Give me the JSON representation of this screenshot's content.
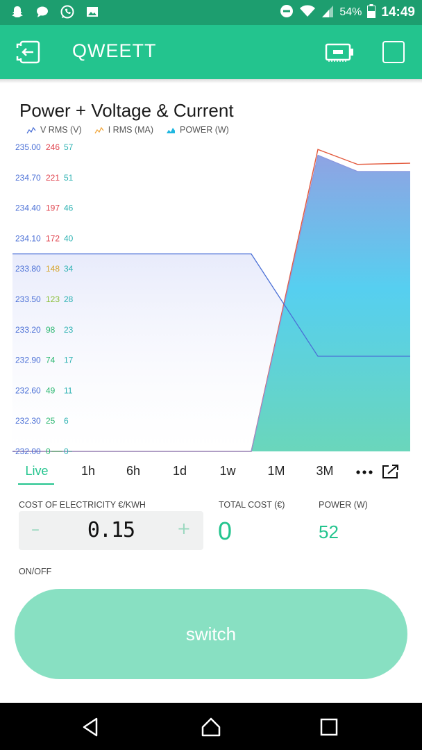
{
  "status_bar": {
    "notifications": [
      "snapchat-icon",
      "chat-icon",
      "whatsapp-icon",
      "gallery-icon"
    ],
    "battery_percent": "54%",
    "time": "14:49"
  },
  "app_bar": {
    "title": "QWEETT"
  },
  "chart": {
    "title": "Power + Voltage & Current",
    "legend": [
      {
        "label": "V RMS (V)",
        "color": "#4a6fd6",
        "icon": "line-chart-icon"
      },
      {
        "label": "I RMS (MA)",
        "color": "#f0a53a",
        "icon": "line-chart-icon"
      },
      {
        "label": "POWER (W)",
        "color": "#1fb7e0",
        "icon": "area-chart-icon"
      }
    ]
  },
  "chart_data": {
    "type": "area",
    "title": "Power + Voltage & Current",
    "xlabel": "",
    "ylabel": "",
    "axes": [
      {
        "name": "V RMS (V)",
        "color": "#4a6fd6",
        "ticks": [
          "235.00",
          "234.70",
          "234.40",
          "234.10",
          "233.80",
          "233.50",
          "233.20",
          "232.90",
          "232.60",
          "232.30",
          "232.00"
        ],
        "ylim": [
          232.0,
          235.0
        ]
      },
      {
        "name": "I RMS (MA)",
        "colors": [
          "#e0434d",
          "#e0434d",
          "#e0434d",
          "#e0434d",
          "#d6a42a",
          "#8cbf3a",
          "#2eb872",
          "#2eb872",
          "#2eb872",
          "#2eb872",
          "#2eb872"
        ],
        "ticks": [
          "246",
          "221",
          "197",
          "172",
          "148",
          "123",
          "98",
          "74",
          "49",
          "25",
          "0"
        ],
        "ylim": [
          0,
          246
        ]
      },
      {
        "name": "POWER (W)",
        "color": "#2fb3b3",
        "ticks": [
          "57",
          "51",
          "46",
          "40",
          "34",
          "28",
          "23",
          "17",
          "11",
          "6",
          "0"
        ],
        "ylim": [
          0,
          57
        ]
      }
    ],
    "x": [
      0,
      1,
      2,
      3,
      4
    ],
    "series": [
      {
        "name": "V RMS (V)",
        "values": [
          233.93,
          233.93,
          232.93,
          232.93,
          232.93
        ]
      },
      {
        "name": "I RMS (MA)",
        "values": [
          0,
          0,
          242,
          230,
          231
        ]
      },
      {
        "name": "POWER (W)",
        "values": [
          0,
          0,
          55,
          52,
          52
        ]
      }
    ],
    "grid": false,
    "legend_position": "top-left"
  },
  "tabs": {
    "items": [
      "Live",
      "1h",
      "6h",
      "1d",
      "1w",
      "1M",
      "3M"
    ],
    "active": "Live"
  },
  "widgets": {
    "cost_label": "COST OF ELECTRICITY €/KWH",
    "cost_value": "0.15",
    "minus": "–",
    "plus": "+",
    "total_label": "TOTAL COST (€)",
    "total_value": "0",
    "power_label": "POWER (W)",
    "power_value": "52",
    "onoff_label": "ON/OFF",
    "switch_label": "switch"
  },
  "colors": {
    "accent": "#23c48e",
    "status_bar": "#1d9e6f",
    "switch_bg": "#88e0c2"
  }
}
